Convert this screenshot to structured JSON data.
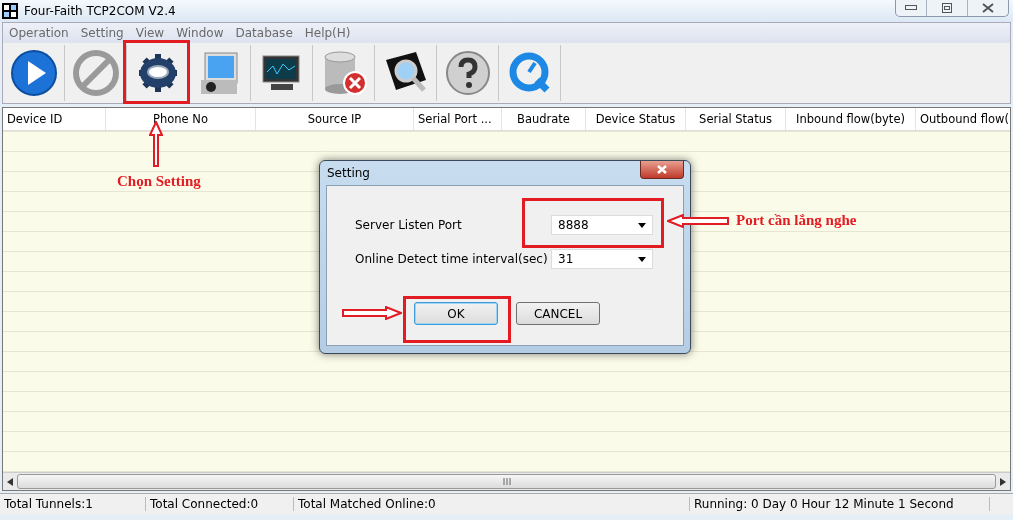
{
  "window": {
    "title": "Four-Faith TCP2COM V2.4"
  },
  "menu": [
    "Operation",
    "Setting",
    "View",
    "Window",
    "Database",
    "Help(H)"
  ],
  "toolbar": [
    {
      "kind": "play"
    },
    {
      "kind": "stop"
    },
    {
      "kind": "gear"
    },
    {
      "kind": "tablet"
    },
    {
      "kind": "monitor"
    },
    {
      "kind": "database"
    },
    {
      "kind": "search"
    },
    {
      "kind": "help"
    },
    {
      "kind": "refresh"
    }
  ],
  "table": {
    "columns": [
      "Device ID",
      "Phone No",
      "Source IP",
      "Serial Port ...",
      "Baudrate",
      "Device Status",
      "Serial Status",
      "Inbound flow(byte)",
      "Outbound flow("
    ]
  },
  "dialog": {
    "title": "Setting",
    "fields": [
      {
        "label": "Server Listen Port",
        "value": "8888"
      },
      {
        "label": "Online Detect time interval(sec)",
        "value": "31"
      }
    ],
    "buttons": [
      {
        "label": "OK",
        "focused": true
      },
      {
        "label": "CANCEL",
        "focused": false
      }
    ]
  },
  "annotations": [
    {
      "text": "Chọn Setting"
    },
    {
      "text": "Port cần lắng nghe"
    }
  ],
  "status_bar": [
    "Total Tunnels:1",
    "Total Connected:0",
    "Total Matched Online:0",
    "Running: 0 Day  0 Hour 12 Minute 1 Second"
  ]
}
